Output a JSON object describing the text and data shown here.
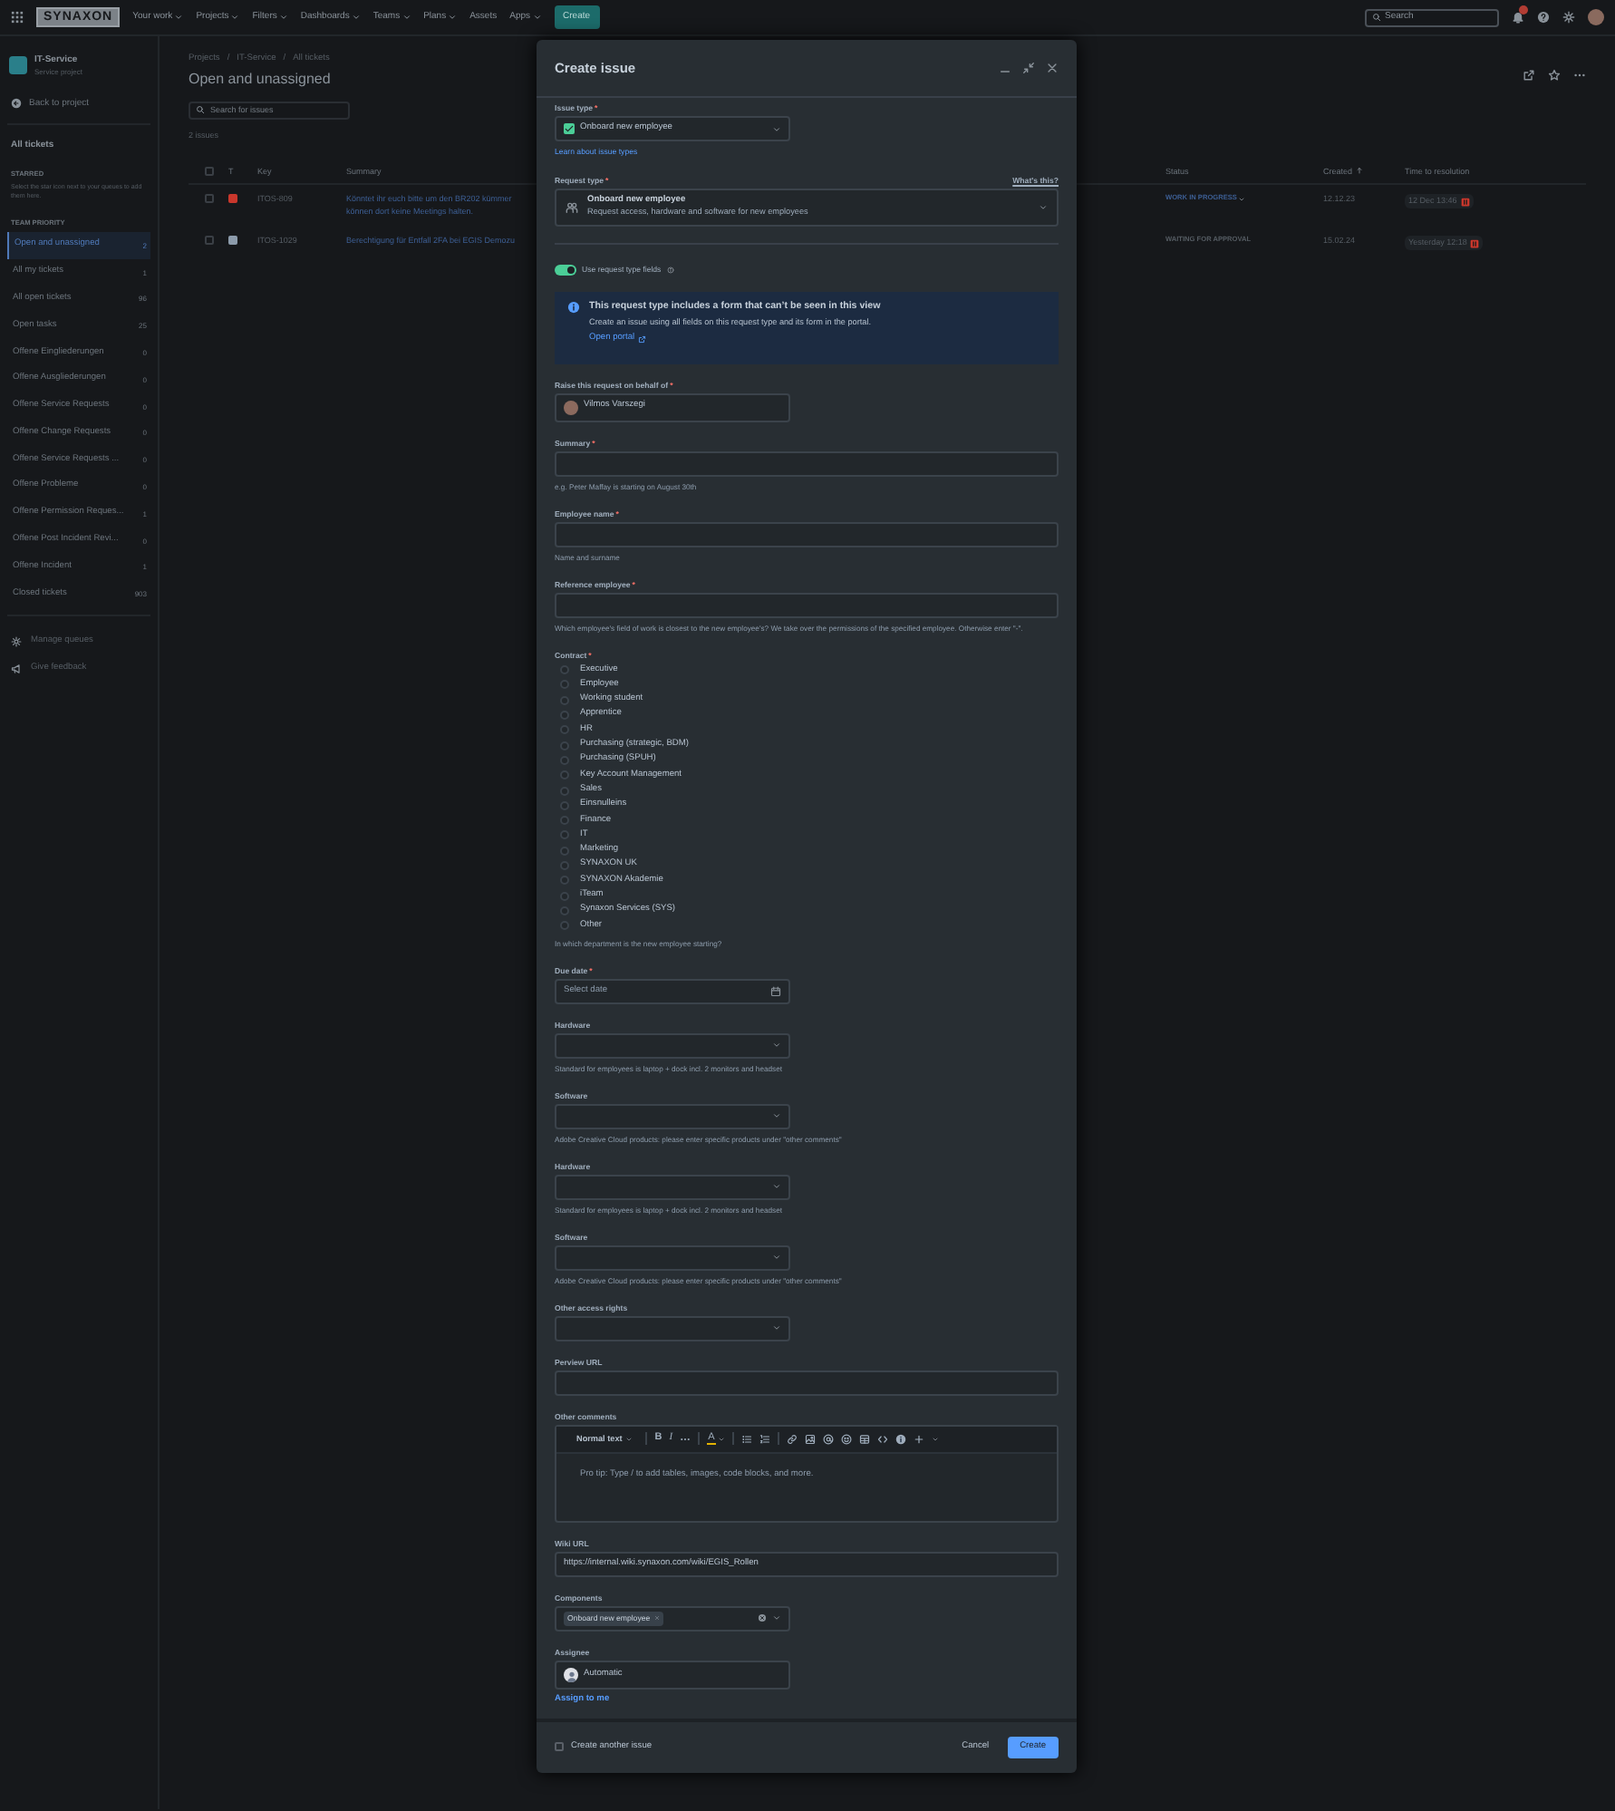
{
  "topnav": {
    "logo": "SYNAXON",
    "menus": [
      {
        "label": "Your work",
        "has_menu": true
      },
      {
        "label": "Projects",
        "has_menu": true
      },
      {
        "label": "Filters",
        "has_menu": true
      },
      {
        "label": "Dashboards",
        "has_menu": true
      },
      {
        "label": "Teams",
        "has_menu": true
      },
      {
        "label": "Plans",
        "has_menu": true
      },
      {
        "label": "Assets",
        "has_menu": false
      },
      {
        "label": "Apps",
        "has_menu": true
      }
    ],
    "create": "Create",
    "search": {
      "placeholder": "Search"
    },
    "notifications": true
  },
  "sidebar": {
    "project": {
      "name": "IT-Service",
      "type": "Service project"
    },
    "back": "Back to project",
    "all_tickets": "All tickets",
    "starred": {
      "heading": "STARRED",
      "hint": "Select the star icon next to your queues to add them here."
    },
    "team_heading": "TEAM PRIORITY",
    "queues": [
      {
        "label": "Open and unassigned",
        "count": "2",
        "selected": true
      },
      {
        "label": "All my tickets",
        "count": "1",
        "selected": false
      },
      {
        "label": "All open tickets",
        "count": "96",
        "selected": false
      },
      {
        "label": "Open tasks",
        "count": "25",
        "selected": false
      },
      {
        "label": "Offene Eingliederungen",
        "count": "0",
        "selected": false
      },
      {
        "label": "Offene Ausgliederungen",
        "count": "0",
        "selected": false
      },
      {
        "label": "Offene Service Requests",
        "count": "0",
        "selected": false
      },
      {
        "label": "Offene Change Requests",
        "count": "0",
        "selected": false
      },
      {
        "label": "Offene Service Requests ...",
        "count": "0",
        "selected": false
      },
      {
        "label": "Offene Probleme",
        "count": "0",
        "selected": false
      },
      {
        "label": "Offene Permission Reques...",
        "count": "1",
        "selected": false
      },
      {
        "label": "Offene Post Incident Revi...",
        "count": "0",
        "selected": false
      },
      {
        "label": "Offene Incident",
        "count": "1",
        "selected": false
      },
      {
        "label": "Closed tickets",
        "count": "903",
        "selected": false
      }
    ],
    "footer": [
      {
        "kind": "manage",
        "label": "Manage queues"
      },
      {
        "kind": "feedback",
        "label": "Give feedback"
      }
    ]
  },
  "page": {
    "breadcrumbs": [
      {
        "label": "Projects",
        "sep": "/"
      },
      {
        "label": "IT-Service",
        "sep": "/"
      },
      {
        "label": "All tickets"
      }
    ],
    "title": "Open and unassigned",
    "search": {
      "placeholder": "Search for issues"
    },
    "count": "2 issues",
    "table": {
      "all_selected": false,
      "columns": [
        {
          "label": "T"
        },
        {
          "label": "Key"
        },
        {
          "label": "Summary"
        },
        {
          "label": "Status"
        },
        {
          "label": "Created",
          "sorted": true
        },
        {
          "label": "Time to resolution"
        }
      ],
      "rows": [
        {
          "selected": false,
          "color": "#c9372c",
          "key": "ITOS-809",
          "summary": [
            "Könntet ihr euch bitte um den BR202 kümmer",
            "können dort keine Meetings halten."
          ],
          "status": {
            "label": "WORK IN PROGRESS",
            "editable": true
          },
          "created": "12.12.23",
          "time": {
            "text": "12 Dec 13:46",
            "paused": true
          }
        },
        {
          "selected": false,
          "color": "#8c9bab",
          "key": "ITOS-1029",
          "summary": [
            "Berechtigung für Entfall 2FA bei EGIS Demozu"
          ],
          "status": {
            "label": "WAITING FOR APPROVAL",
            "editable": false
          },
          "created": "15.02.24",
          "time": {
            "text": "Yesterday 12:18",
            "paused": true
          }
        }
      ]
    }
  },
  "modal": {
    "title": "Create issue",
    "fields": [
      {
        "kind": "select",
        "label": "Issue type",
        "mark": "*",
        "value": "Onboard new employee",
        "icon": true,
        "link": "Learn about issue types"
      },
      {
        "kind": "request",
        "label": "Request type",
        "mark": "*",
        "aside": "What's this?",
        "value": "Onboard new employee",
        "description": "Request access, hardware and software for new employees"
      },
      {
        "kind": "toggle",
        "label": "Use request type fields",
        "on": true
      },
      {
        "kind": "info",
        "title": "This request type includes a form that can’t be seen in this view",
        "text": "Create an issue using all fields on this request type and its form in the portal.",
        "link": "Open portal"
      },
      {
        "kind": "user",
        "label": "Raise this request on behalf of",
        "mark": "*",
        "value": "Vilmos Varszegi"
      },
      {
        "kind": "text",
        "label": "Summary",
        "mark": "*",
        "hint": "e.g. Peter Maffay is starting on August 30th"
      },
      {
        "kind": "text",
        "label": "Employee name",
        "mark": "*",
        "hint": "Name and surname"
      },
      {
        "kind": "text",
        "label": "Reference employee",
        "mark": "*",
        "hint": "Which employee's field of work is closest to the new employee's? We take over the permissions of the specified employee. Otherwise enter \"-\"."
      },
      {
        "kind": "radios",
        "label": "Contract",
        "mark": "*",
        "options": [
          {
            "label": "Executive",
            "selected": false
          },
          {
            "label": "Employee",
            "selected": false
          },
          {
            "label": "Working student",
            "selected": false
          },
          {
            "label": "Apprentice",
            "selected": false
          },
          {
            "label": "HR",
            "selected": false
          },
          {
            "label": "Purchasing (strategic, BDM)",
            "selected": false
          },
          {
            "label": "Purchasing (SPUH)",
            "selected": false
          },
          {
            "label": "Key Account Management",
            "selected": false
          },
          {
            "label": "Sales",
            "selected": false
          },
          {
            "label": "Einsnulleins",
            "selected": false
          },
          {
            "label": "Finance",
            "selected": false
          },
          {
            "label": "IT",
            "selected": false
          },
          {
            "label": "Marketing",
            "selected": false
          },
          {
            "label": "SYNAXON UK",
            "selected": false
          },
          {
            "label": "SYNAXON Akademie",
            "selected": false
          },
          {
            "label": "iTeam",
            "selected": false
          },
          {
            "label": "Synaxon Services (SYS)",
            "selected": false
          },
          {
            "label": "Other",
            "selected": false
          }
        ],
        "hint": "In which department is the new employee starting?"
      },
      {
        "kind": "date",
        "label": "Due date",
        "mark": "*",
        "placeholder": "Select date"
      },
      {
        "kind": "select",
        "label": "Hardware",
        "hint": "Standard for employees is laptop + dock incl. 2 monitors and headset"
      },
      {
        "kind": "select",
        "label": "Software",
        "hint": "Adobe Creative Cloud products: please enter specific products under \"other comments\""
      },
      {
        "kind": "select",
        "label": "Hardware",
        "hint": "Standard for employees is laptop + dock incl. 2 monitors and headset"
      },
      {
        "kind": "select",
        "label": "Software",
        "hint": "Adobe Creative Cloud products: please enter specific products under \"other comments\""
      },
      {
        "kind": "select",
        "label": "Other access rights"
      },
      {
        "kind": "text",
        "label": "Perview URL"
      },
      {
        "kind": "editor",
        "label": "Other comments",
        "style": "Normal text",
        "placeholder": "Pro tip: Type / to add tables, images, code blocks, and more.",
        "tools": [
          {
            "kind": "separator"
          },
          {
            "kind": "bold",
            "glyph": "B"
          },
          {
            "kind": "italic",
            "glyph": "I"
          },
          {
            "kind": "more"
          },
          {
            "kind": "separator"
          },
          {
            "kind": "color",
            "glyph": "A"
          },
          {
            "kind": "separator"
          },
          {
            "kind": "bullets"
          },
          {
            "kind": "numbers"
          },
          {
            "kind": "separator"
          },
          {
            "kind": "link"
          },
          {
            "kind": "image"
          },
          {
            "kind": "mention"
          },
          {
            "kind": "emoji"
          },
          {
            "kind": "table"
          },
          {
            "kind": "code"
          },
          {
            "kind": "info"
          },
          {
            "kind": "insert"
          }
        ]
      },
      {
        "kind": "text",
        "label": "Wiki URL",
        "value": "https://internal.wiki.synaxon.com/wiki/EGIS_Rollen"
      },
      {
        "kind": "tags",
        "label": "Components",
        "tags": [
          "Onboard new employee"
        ]
      },
      {
        "kind": "user",
        "label": "Assignee",
        "value": "Automatic",
        "generic": true,
        "link": "Assign to me"
      }
    ],
    "footer": {
      "another": {
        "label": "Create another issue",
        "checked": false
      },
      "cancel": "Cancel",
      "submit": "Create"
    }
  }
}
